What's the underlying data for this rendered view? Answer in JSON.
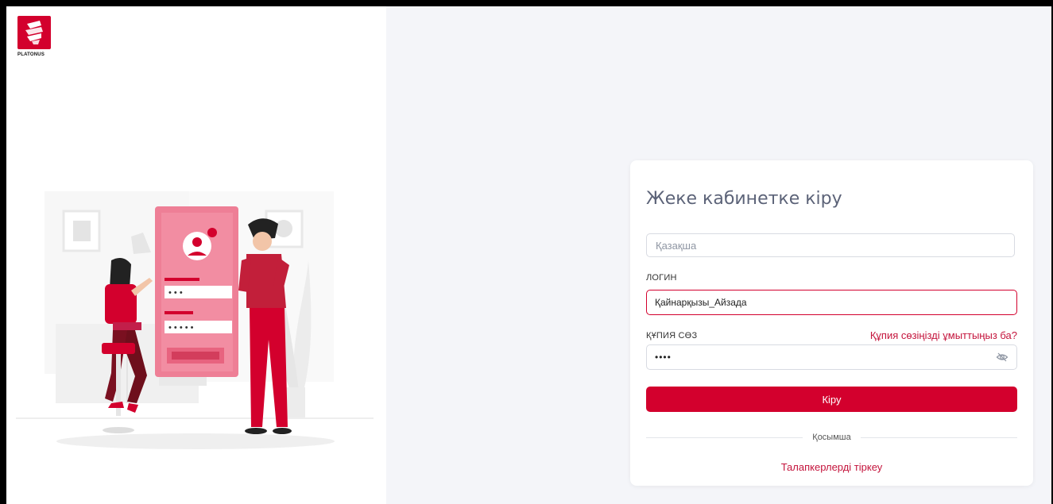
{
  "brand": {
    "name": "PLATONUS",
    "accent_color": "#d3002d",
    "logo_icon": "platonus-logo-icon"
  },
  "illustration": {
    "password_dots_1": "• • •",
    "password_dots_2": "• • • • •"
  },
  "login_card": {
    "title": "Жеке кабинетке кіру",
    "language_select": {
      "value": "Қазақша"
    },
    "login_label": "ЛОГИН",
    "login_value": "Қайнарқызы_Айзада",
    "password_label": "ҚҰПИЯ СӨЗ",
    "forgot_password": "Құпия сөзіңізді ұмыттыңыз ба?",
    "password_value": "••••",
    "password_toggle_icon": "eye-slash-icon",
    "submit_label": "Кіру",
    "divider_text": "Қосымша",
    "register_link": "Талапкерлерді тіркеу"
  }
}
